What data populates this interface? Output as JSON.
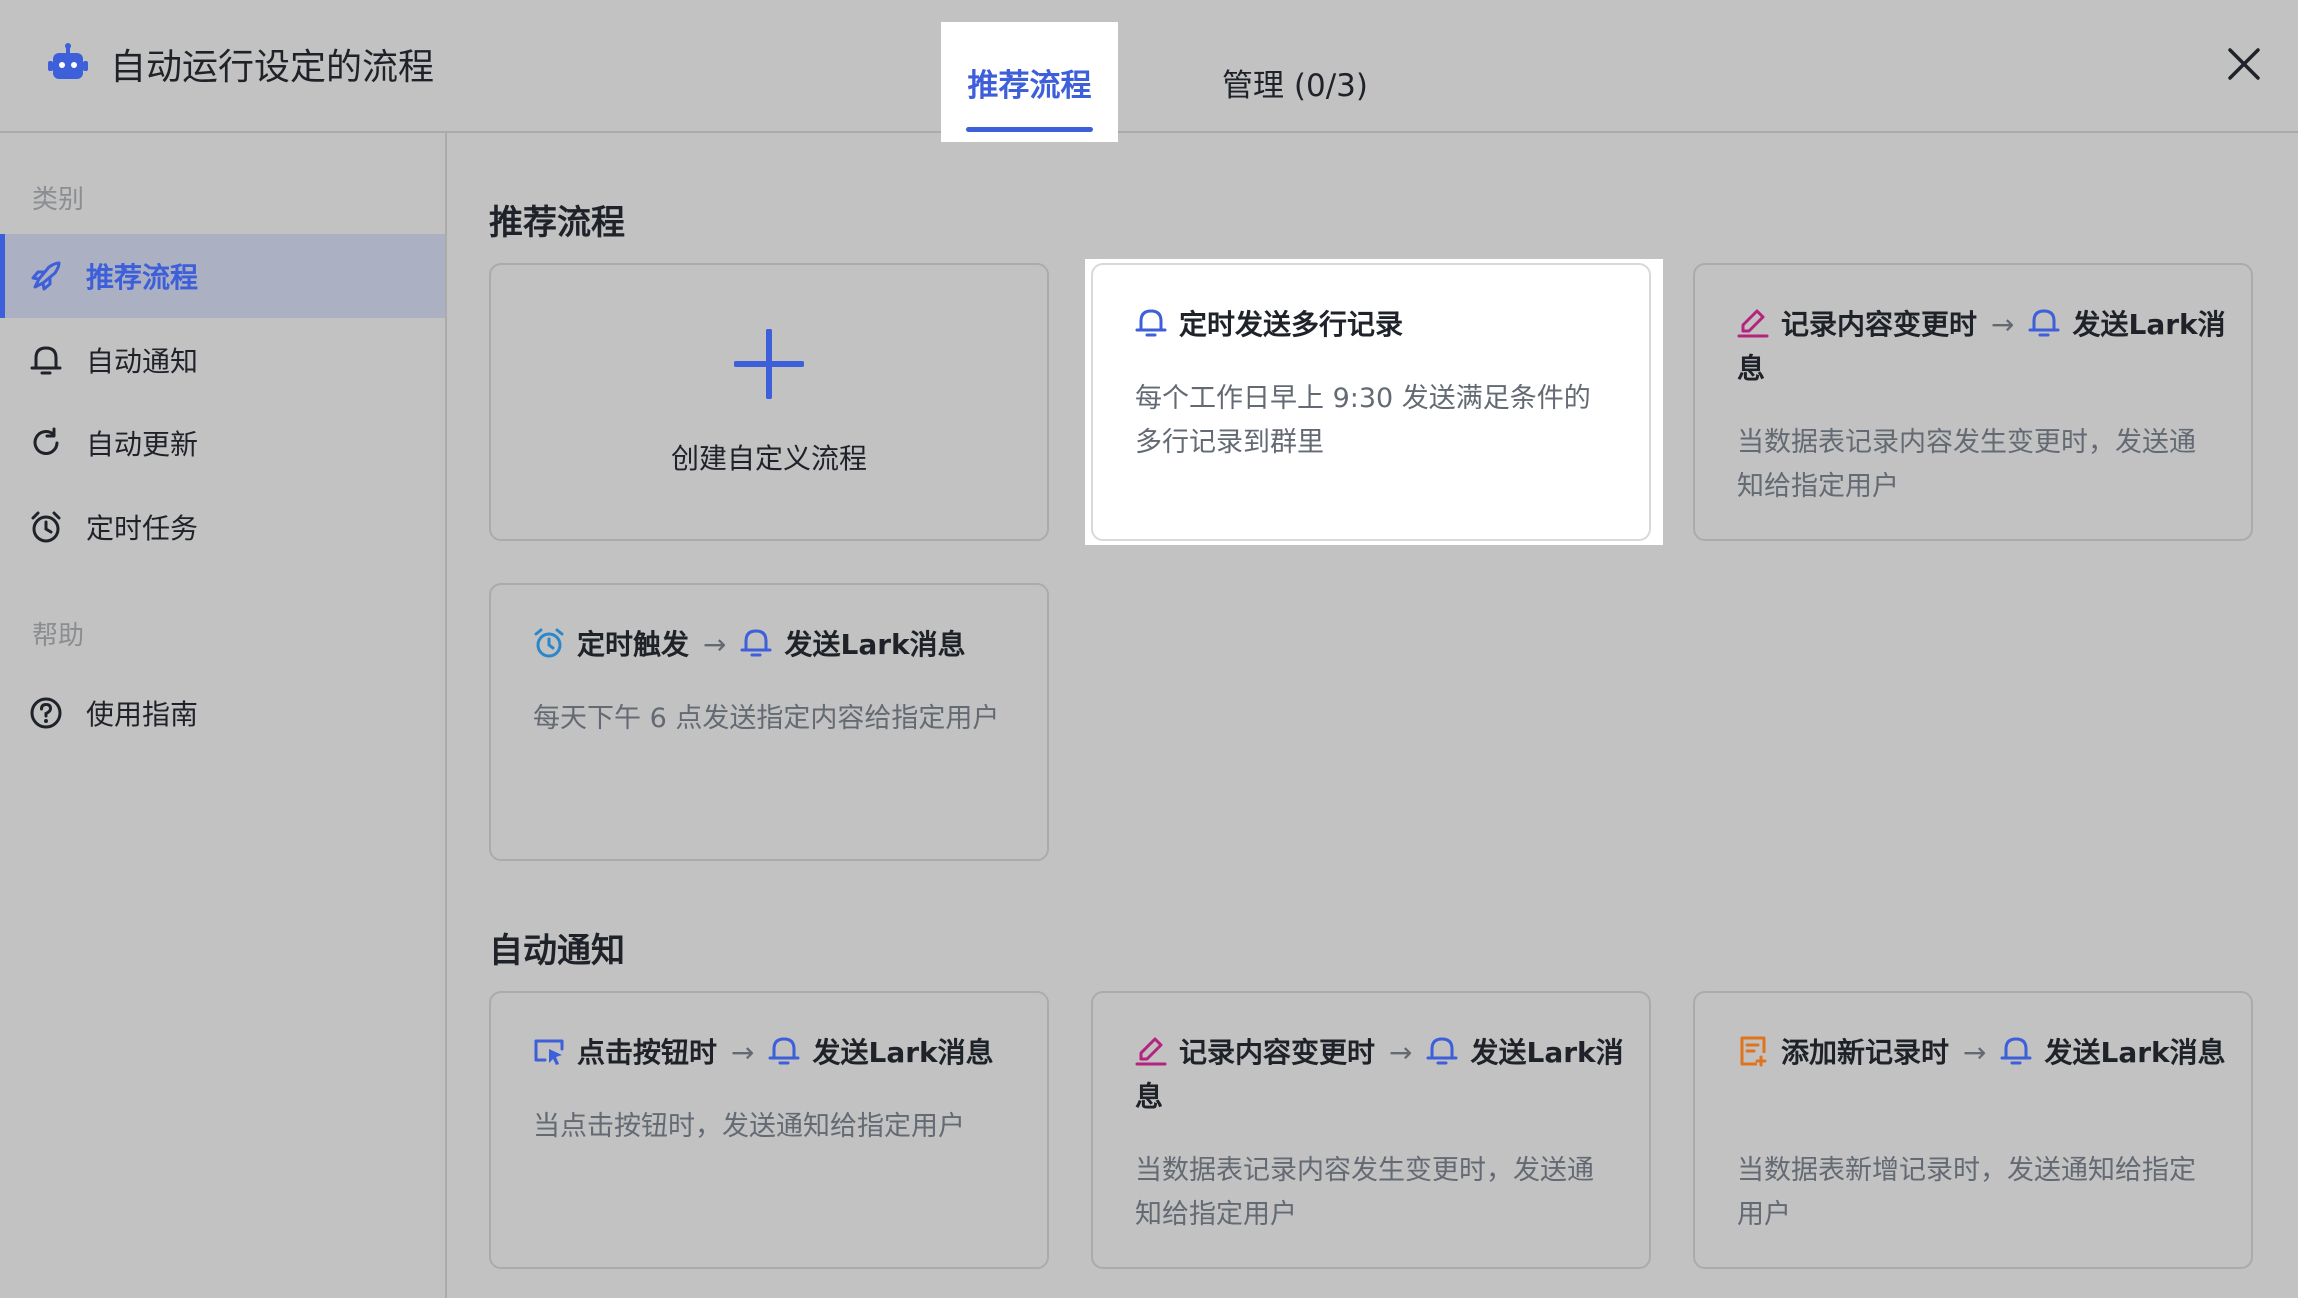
{
  "header": {
    "title": "自动运行设定的流程",
    "tabs": [
      {
        "label": "推荐流程",
        "active": true
      },
      {
        "label": "管理 (0/3)",
        "active": false
      }
    ]
  },
  "sidebar": {
    "category_label": "类别",
    "items": [
      {
        "label": "推荐流程",
        "icon": "rocket-icon",
        "active": true
      },
      {
        "label": "自动通知",
        "icon": "bell-icon"
      },
      {
        "label": "自动更新",
        "icon": "refresh-icon"
      },
      {
        "label": "定时任务",
        "icon": "alarm-clock-icon"
      }
    ],
    "help_label": "帮助",
    "help_items": [
      {
        "label": "使用指南",
        "icon": "question-icon"
      }
    ]
  },
  "sections": {
    "recommended": {
      "title": "推荐流程",
      "create_label": "创建自定义流程",
      "cards": [
        {
          "trigger": "定时发送多行记录",
          "desc": "每个工作日早上 9:30 发送满足条件的多行记录到群里"
        },
        {
          "trigger": "记录内容变更时",
          "action": "发送Lark消息",
          "desc": "当数据表记录内容发生变更时，发送通知给指定用户"
        },
        {
          "trigger": "定时触发",
          "action": "发送Lark消息",
          "desc": "每天下午 6 点发送指定内容给指定用户"
        }
      ]
    },
    "auto_notify": {
      "title": "自动通知",
      "cards": [
        {
          "trigger": "点击按钮时",
          "action": "发送Lark消息",
          "desc": "当点击按钮时，发送通知给指定用户"
        },
        {
          "trigger": "记录内容变更时",
          "action": "发送Lark消息",
          "desc": "当数据表记录内容发生变更时，发送通知给指定用户"
        },
        {
          "trigger": "添加新记录时",
          "action": "发送Lark消息",
          "desc": "当数据表新增记录时，发送通知给指定用户"
        }
      ]
    }
  },
  "arrow": "→",
  "colors": {
    "accent": "#3d5fd9",
    "pencil": "#b4237d",
    "doc": "#e0741e",
    "clock": "#2b87c9"
  }
}
